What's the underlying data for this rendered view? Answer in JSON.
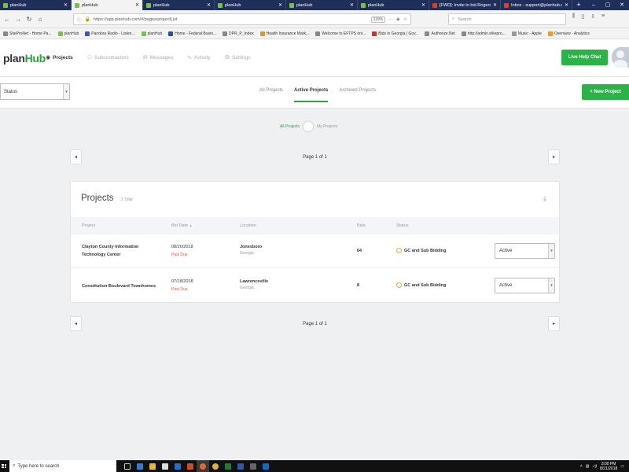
{
  "browser": {
    "tabs": [
      {
        "label": "planHub",
        "favicon": "green",
        "active": false
      },
      {
        "label": "planHub",
        "favicon": "green",
        "active": true
      },
      {
        "label": "planHub",
        "favicon": "green",
        "active": false
      },
      {
        "label": "planHub",
        "favicon": "green",
        "active": false
      },
      {
        "label": "planHub",
        "favicon": "green",
        "active": false
      },
      {
        "label": "planHub",
        "favicon": "green",
        "active": false
      },
      {
        "label": "[FWD]: Invite to bid Rogers",
        "favicon": "red",
        "active": false
      },
      {
        "label": "Inbox - support@planhub.c",
        "favicon": "red",
        "active": false
      }
    ],
    "url": "https://app.planhub.com/#/pages/projectList",
    "zoom": "110%",
    "search_placeholder": "Search",
    "bookmarks": [
      "SiteProNet - Home Pa...",
      "planHub",
      "Pandora Radio - Listen...",
      "planHub",
      "Home - Federal Busin...",
      "DPR_P_Index",
      "Health Insurance Mark...",
      "Welcome to EFTPS onl...",
      "Bids in Georgia | Gov...",
      "Authorize.Net",
      "http://admin.elitepro...",
      "Music - Apple",
      "Overview - Analytics"
    ]
  },
  "app": {
    "logo_plan": "plan",
    "logo_hub": "Hub",
    "nav": [
      {
        "label": "Projects",
        "icon": "target-icon",
        "active": true
      },
      {
        "label": "Subcontractors",
        "icon": "group-icon",
        "active": false
      },
      {
        "label": "Messages",
        "icon": "chat-icon",
        "active": false
      },
      {
        "label": "Activity",
        "icon": "activity-icon",
        "active": false
      },
      {
        "label": "Settings",
        "icon": "gear-icon",
        "active": false
      }
    ],
    "help_button": "Live Help Chat",
    "status_filter": "Status",
    "subtabs": [
      {
        "label": "All Projects",
        "active": false
      },
      {
        "label": "Active Projects",
        "active": true
      },
      {
        "label": "Archived Projects",
        "active": false
      }
    ],
    "new_project_button": "+ New Project",
    "toggle": {
      "left_label": "All Projects",
      "right_label": "My Projects"
    },
    "pager": {
      "text": "Page 1 of 1"
    },
    "projects": {
      "title": "Projects",
      "count": "2 Total",
      "columns": [
        "Project",
        "Bid Date",
        "Location",
        "Bids",
        "Status"
      ],
      "sort_indicator": "▲",
      "rows": [
        {
          "project": "Clayton County Information Technology Center",
          "bid_date": "08/20/2018",
          "due_label": "Past Due",
          "city": "Jonesboro",
          "state": "Georgia",
          "bids": "64",
          "status": "GC and Sub Bidding",
          "select": "Active"
        },
        {
          "project": "Constitution Boulevard Townhomes",
          "bid_date": "07/18/2018",
          "due_label": "Past Due",
          "city": "Lawrenceville",
          "state": "Georgia",
          "bids": "8",
          "status": "GC and Sub Bidding",
          "select": "Active"
        }
      ]
    }
  },
  "taskbar": {
    "search_placeholder": "Type here to search",
    "time": "3:00 PM",
    "date": "8/21/2018"
  },
  "colors": {
    "brand_green": "#2db24a",
    "status_orange": "#f0a93a",
    "past_due_red": "#e05a3a"
  }
}
